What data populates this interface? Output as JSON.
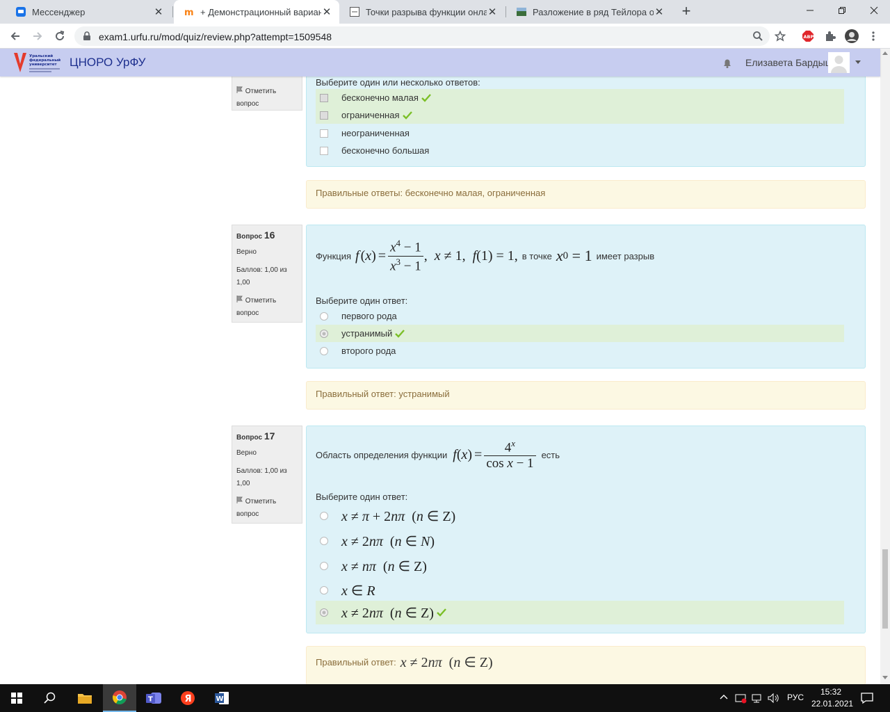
{
  "browser": {
    "tabs": [
      {
        "title": "Мессенджер",
        "icon": "messenger-icon"
      },
      {
        "title": "+ Демонстрационный вариант",
        "icon": "moodle-icon"
      },
      {
        "title": "Точки разрыва функции онлайн",
        "icon": "page-icon"
      },
      {
        "title": "Разложение в ряд Тейлора онлайн",
        "icon": "image-icon"
      }
    ],
    "url": "exam1.urfu.ru/mod/quiz/review.php?attempt=1509548"
  },
  "site": {
    "logo_text": "Уральский федеральный университет",
    "name": "ЦНОРО УрФУ",
    "user_name": "Елизавета Бардыш"
  },
  "q15": {
    "flag_label": "Отметить вопрос",
    "prompt": "Выберите один или несколько ответов:",
    "answers": [
      {
        "label": "бесконечно малая",
        "checked": true,
        "correct": true
      },
      {
        "label": "ограниченная",
        "checked": true,
        "correct": true
      },
      {
        "label": "неограниченная",
        "checked": false,
        "correct": false
      },
      {
        "label": "бесконечно большая",
        "checked": false,
        "correct": false
      }
    ],
    "feedback": "Правильные ответы: бесконечно малая, ограниченная"
  },
  "q16": {
    "label": "Вопрос",
    "number": "16",
    "state": "Верно",
    "grade": "Баллов: 1,00 из 1,00",
    "flag_label": "Отметить вопрос",
    "text_before": "Функция",
    "text_middle": "в точке",
    "text_after": "имеет разрыв",
    "prompt": "Выберите один ответ:",
    "answers": [
      {
        "label": "первого рода"
      },
      {
        "label": "устранимый"
      },
      {
        "label": "второго рода"
      }
    ],
    "feedback": "Правильный ответ: устранимый"
  },
  "q17": {
    "label": "Вопрос",
    "number": "17",
    "state": "Верно",
    "grade": "Баллов: 1,00 из 1,00",
    "flag_label": "Отметить вопрос",
    "text_before": "Область определения функции",
    "text_after": "есть",
    "prompt": "Выберите один ответ:",
    "feedback_label": "Правильный ответ:"
  },
  "taskbar": {
    "lang": "РУС",
    "time": "15:32",
    "date": "22.01.2021"
  },
  "colors": {
    "header": "#c7cdf0",
    "formulation": "#def2f8",
    "feedback": "#fcf8e3",
    "correct_answer": "#dff0d8",
    "tick": "#7bbf27"
  }
}
